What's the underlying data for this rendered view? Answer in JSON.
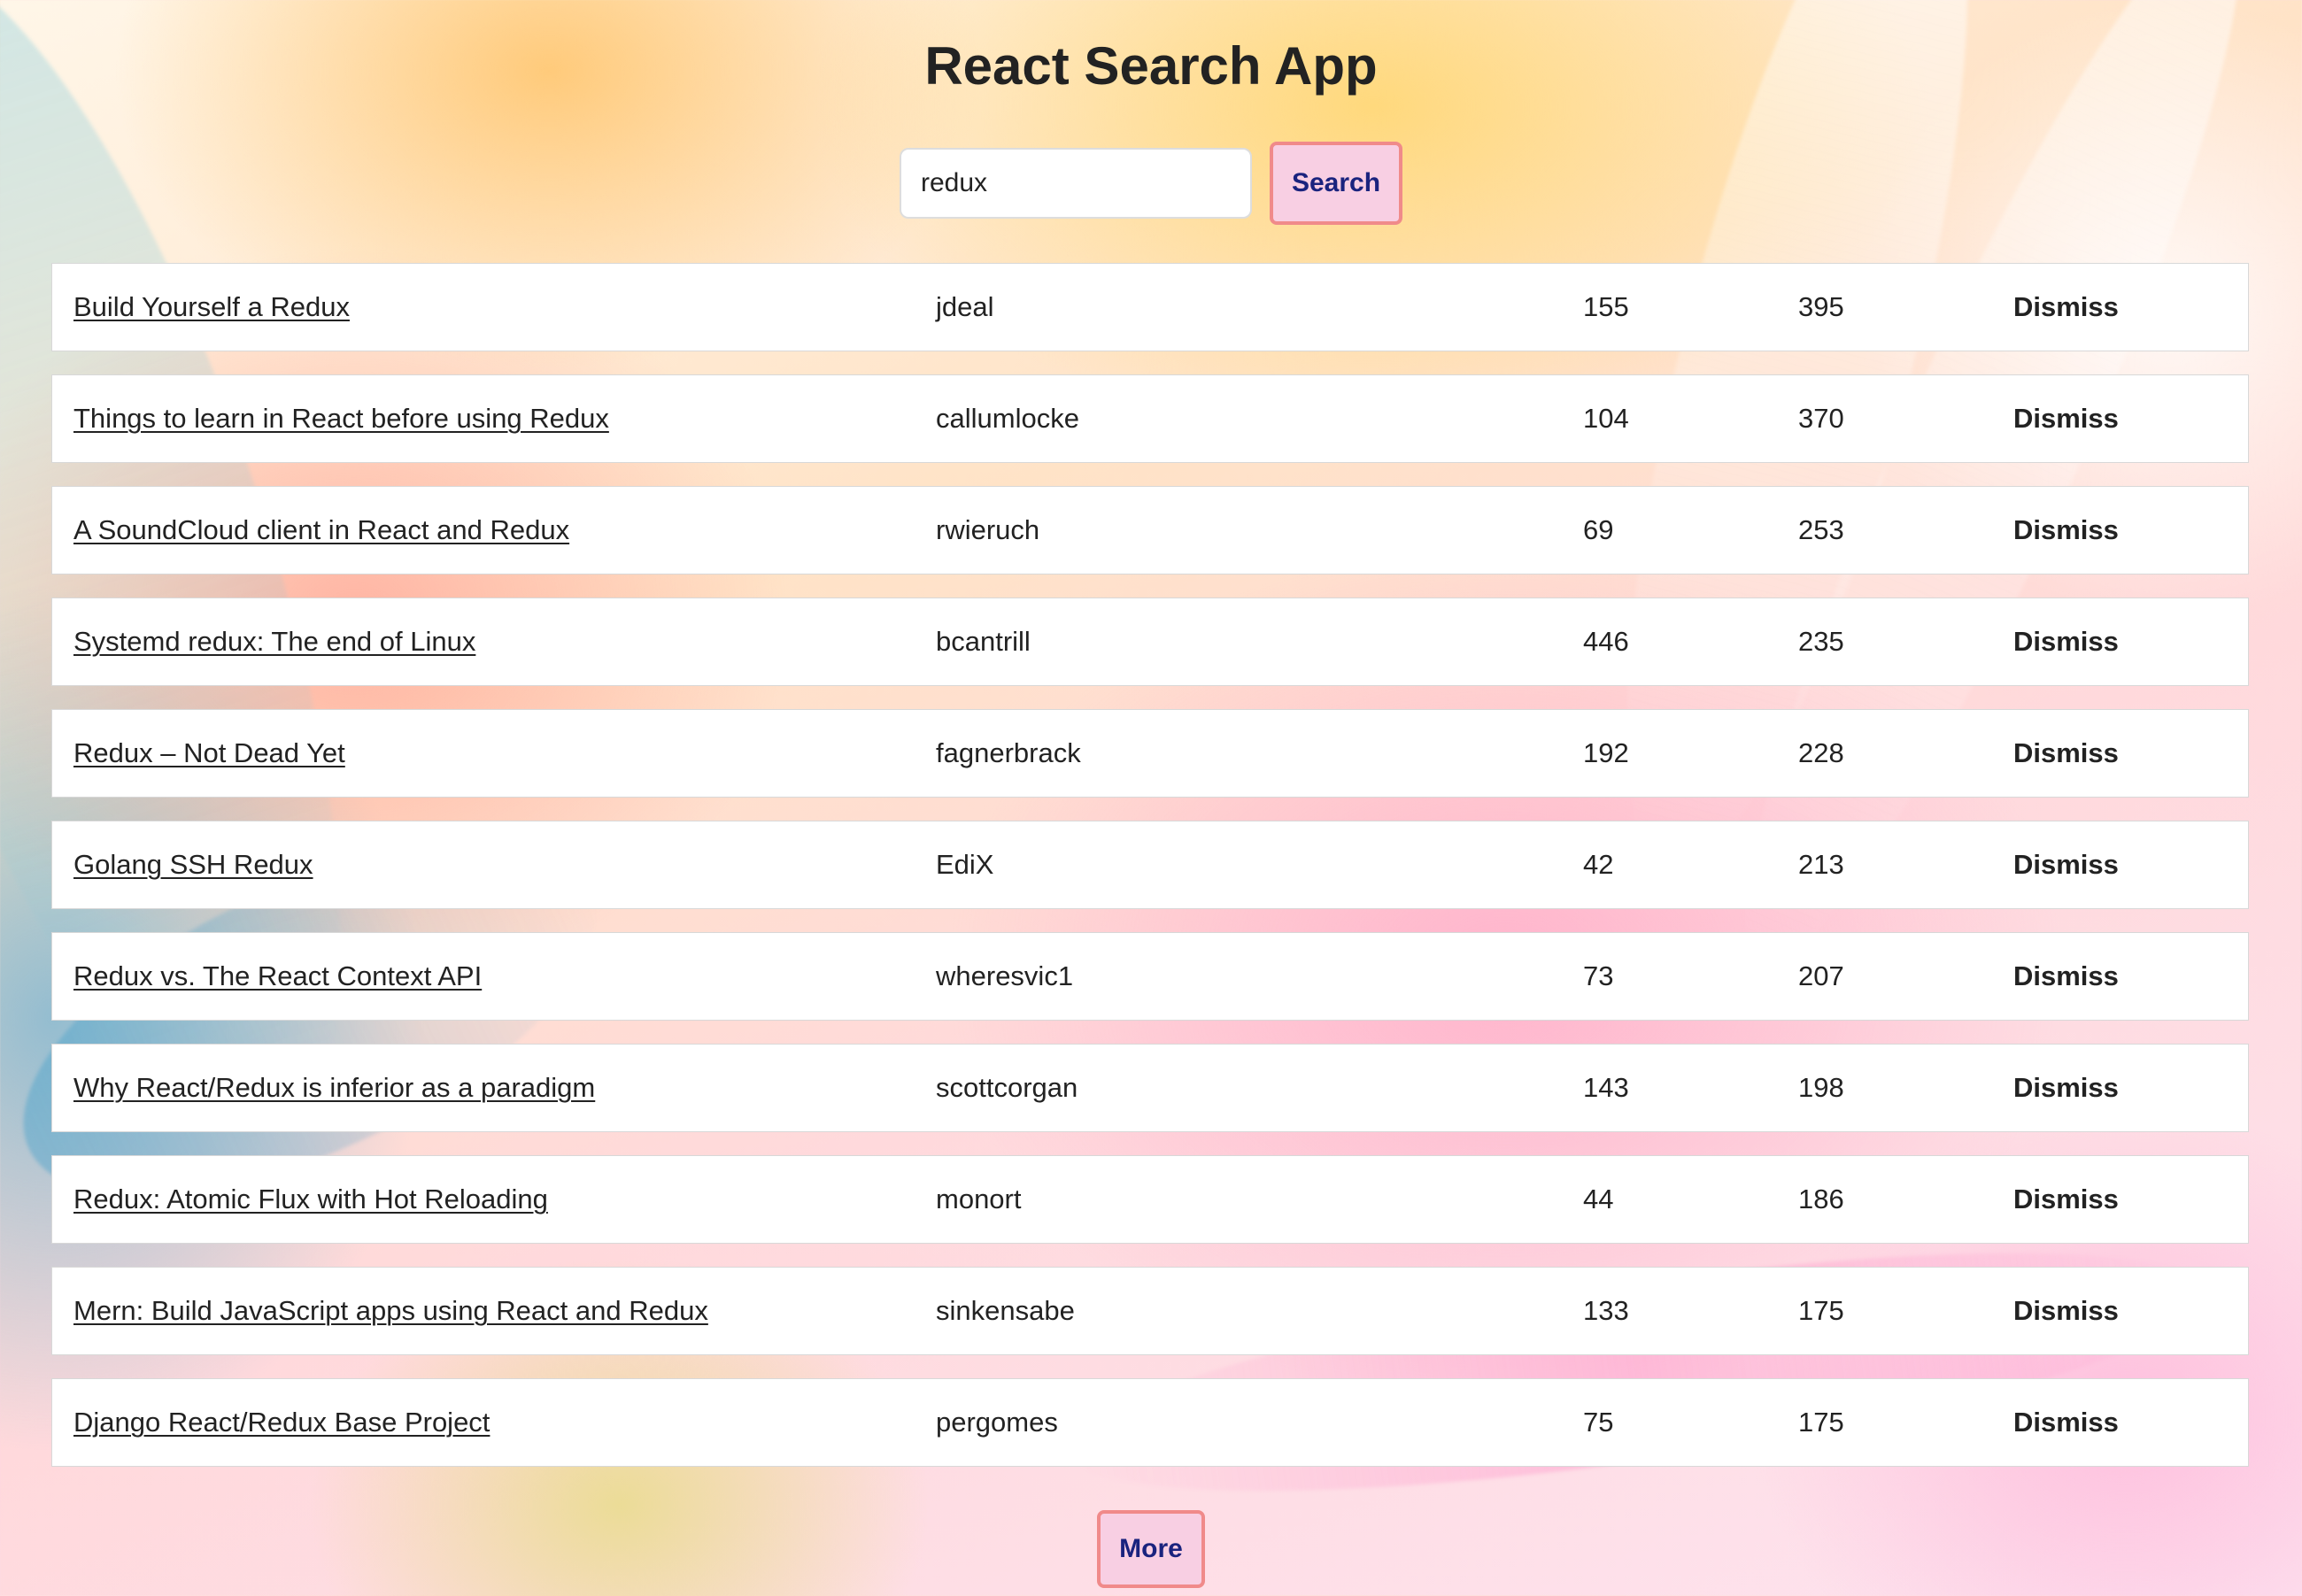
{
  "app": {
    "title": "React Search App"
  },
  "search": {
    "value": "redux",
    "button_label": "Search"
  },
  "results": [
    {
      "title": "Build Yourself a Redux",
      "author": "jdeal",
      "comments": "155",
      "points": "395",
      "dismiss": "Dismiss"
    },
    {
      "title": "Things to learn in React before using Redux",
      "author": "callumlocke",
      "comments": "104",
      "points": "370",
      "dismiss": "Dismiss"
    },
    {
      "title": "A SoundCloud client in React and Redux",
      "author": "rwieruch",
      "comments": "69",
      "points": "253",
      "dismiss": "Dismiss"
    },
    {
      "title": "Systemd redux: The end of Linux",
      "author": "bcantrill",
      "comments": "446",
      "points": "235",
      "dismiss": "Dismiss"
    },
    {
      "title": "Redux – Not Dead Yet",
      "author": "fagnerbrack",
      "comments": "192",
      "points": "228",
      "dismiss": "Dismiss"
    },
    {
      "title": "Golang SSH Redux",
      "author": "EdiX",
      "comments": "42",
      "points": "213",
      "dismiss": "Dismiss"
    },
    {
      "title": "Redux vs. The React Context API",
      "author": "wheresvic1",
      "comments": "73",
      "points": "207",
      "dismiss": "Dismiss"
    },
    {
      "title": "Why React/Redux is inferior as a paradigm",
      "author": "scottcorgan",
      "comments": "143",
      "points": "198",
      "dismiss": "Dismiss"
    },
    {
      "title": "Redux: Atomic Flux with Hot Reloading",
      "author": "monort",
      "comments": "44",
      "points": "186",
      "dismiss": "Dismiss"
    },
    {
      "title": "Mern: Build JavaScript apps using React and Redux",
      "author": "sinkensabe",
      "comments": "133",
      "points": "175",
      "dismiss": "Dismiss"
    },
    {
      "title": "Django React/Redux Base Project",
      "author": "pergomes",
      "comments": "75",
      "points": "175",
      "dismiss": "Dismiss"
    }
  ],
  "more": {
    "label": "More"
  },
  "colors": {
    "button_bg": "#f8cfe3",
    "button_border": "#f08a8a",
    "button_text": "#1a237e"
  }
}
